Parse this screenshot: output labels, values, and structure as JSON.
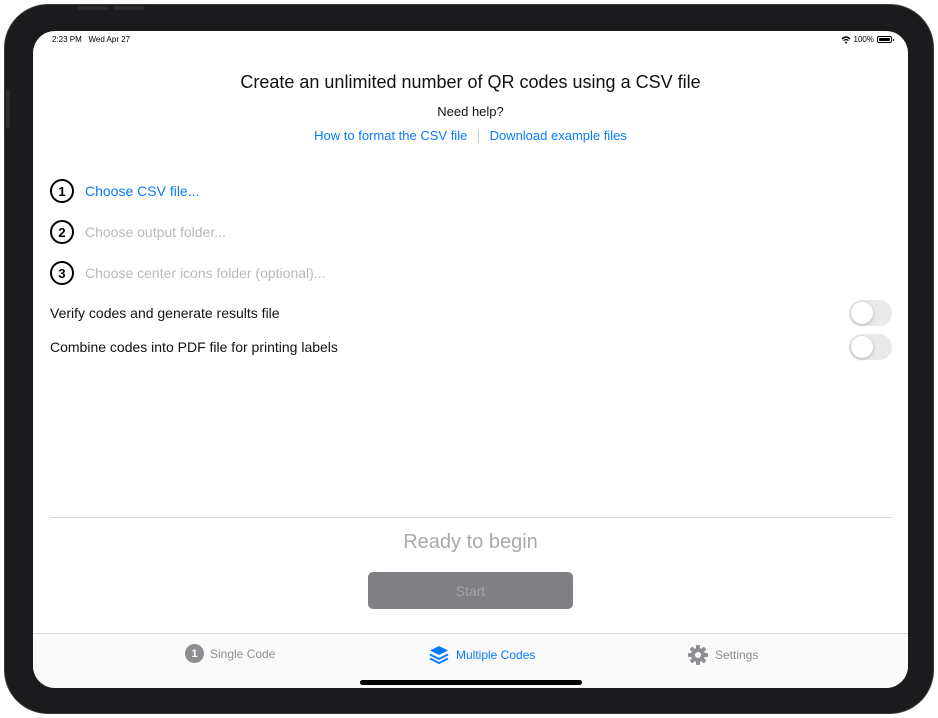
{
  "status_bar": {
    "time": "2:23 PM",
    "date": "Wed Apr 27",
    "battery": "100%"
  },
  "header": {
    "title": "Create an unlimited number of QR codes using a CSV file",
    "help": "Need help?",
    "links": [
      {
        "label": "How to format the CSV file"
      },
      {
        "label": "Download example files"
      }
    ]
  },
  "steps": [
    {
      "number": "1",
      "label": "Choose CSV file...",
      "state": "active"
    },
    {
      "number": "2",
      "label": "Choose output folder...",
      "state": "disabled"
    },
    {
      "number": "3",
      "label": "Choose center icons folder (optional)...",
      "state": "disabled"
    }
  ],
  "options": [
    {
      "label": "Verify codes and generate results file",
      "enabled": false
    },
    {
      "label": "Combine codes into PDF file for printing labels",
      "enabled": false
    }
  ],
  "status_text": "Ready to begin",
  "start_button": {
    "label": "Start",
    "enabled": false
  },
  "tabs": [
    {
      "label": "Single Code",
      "badge": "1",
      "selected": false,
      "icon": "number-one-circle-icon"
    },
    {
      "label": "Multiple Codes",
      "selected": true,
      "icon": "stack-layers-icon"
    },
    {
      "label": "Settings",
      "selected": false,
      "icon": "gear-icon"
    }
  ],
  "colors": {
    "accent": "#0a7aff",
    "disabled_text": "#b9b9bd",
    "tab_inactive": "#8e8e93"
  }
}
